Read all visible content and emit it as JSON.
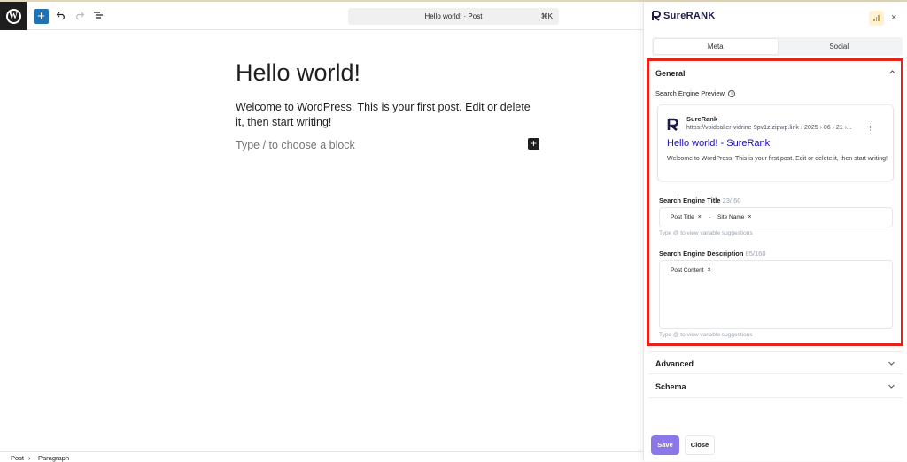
{
  "toolbar": {
    "wp_logo_letter": "W",
    "add_block_symbol": "+",
    "document_title": "Hello world! · Post",
    "shortcut": "⌘K"
  },
  "editor": {
    "title": "Hello world!",
    "paragraph": "Welcome to WordPress. This is your first post. Edit or delete it, then start writing!",
    "placeholder": "Type / to choose a block",
    "inserter_symbol": "+"
  },
  "breadcrumb": {
    "items": [
      "Post",
      "Paragraph"
    ],
    "separator": "›"
  },
  "panel": {
    "brand": "SureRANK",
    "close_symbol": "×",
    "tabs": [
      {
        "label": "Meta",
        "active": true
      },
      {
        "label": "Social",
        "active": false
      }
    ],
    "general": {
      "title": "General",
      "preview_label": "Search Engine Preview",
      "preview": {
        "site_name": "SureRank",
        "url": "https://voidcaller-vidrine-9pv1z.zipwp.link › 2025 › 06 › 21 ›...",
        "kebab": "⋮",
        "title": "Hello world! - SureRank",
        "description": "Welcome to WordPress. This is your first post. Edit or delete it, then start writing!"
      },
      "title_field": {
        "label": "Search Engine Title",
        "count": "23/ 60",
        "chips": [
          "Post Title",
          "Site Name"
        ],
        "separator": "-",
        "hint": "Type @ to view variable suggestions"
      },
      "description_field": {
        "label": "Search Engine Description",
        "count": "85/160",
        "chips": [
          "Post Content"
        ],
        "hint": "Type @ to view variable suggestions"
      }
    },
    "sections": {
      "advanced": "Advanced",
      "schema": "Schema"
    },
    "buttons": {
      "save": "Save",
      "close": "Close"
    }
  },
  "colors": {
    "brand_dark": "#1e1b4b",
    "wp_blue": "#2271b1",
    "save_purple": "#8b77e8",
    "highlight_red": "#e1251b",
    "preview_link": "#1a0dab"
  }
}
